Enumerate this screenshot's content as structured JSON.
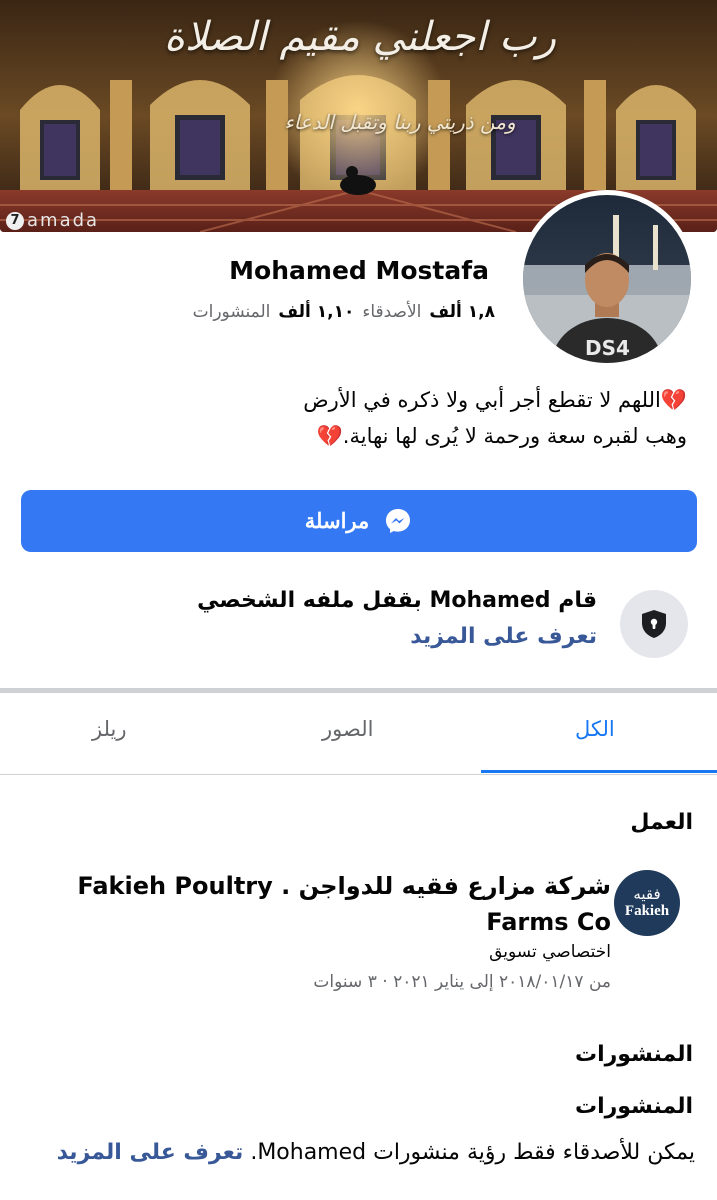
{
  "cover": {
    "title": "رب اجعلني مقيم الصلاة",
    "subtitle": "ومن ذريتي ربنا وتقبل الدعاء",
    "watermark_digit": "7",
    "watermark_text": "amada"
  },
  "profile": {
    "name": "Mohamed Mostafa",
    "friends_count": "١,٨ ألف",
    "friends_label": "الأصدقاء",
    "posts_count": "١,١٠ ألف",
    "posts_label": "المنشورات"
  },
  "bio": {
    "line1": "💔اللهم لا تقطع أجر أبي ولا ذكره في الأرض",
    "line2": "وهب لقبره سعة ورحمة لا يُرى لها نهاية.💔"
  },
  "message_button": {
    "label": "مراسلة",
    "color": "#3578f3"
  },
  "locked_profile": {
    "text": "قام Mohamed بقفل ملفه الشخصي",
    "link": "تعرف على المزيد"
  },
  "tabs": [
    {
      "label": "الكل",
      "active": true
    },
    {
      "label": "الصور",
      "active": false
    },
    {
      "label": "ريلز",
      "active": false
    }
  ],
  "work": {
    "section_title": "العمل",
    "logo_ar": "فقيه",
    "logo_en": "Fakieh",
    "company": "شركة مزارع فقيه للدواجن . Fakieh Poultry Farms Co",
    "job_title": "اختصاصي تسويق",
    "dates": "من ٢٠١٨/٠١/١٧ إلى يناير ٢٠٢١ · ٣ سنوات"
  },
  "posts": {
    "section_title": "المنشورات",
    "subtitle": "المنشورات",
    "privacy_text": "يمكن للأصدقاء فقط رؤية منشورات Mohamed.",
    "privacy_link": "تعرف على المزيد"
  },
  "colors": {
    "accent": "#1877f2",
    "link": "#385898",
    "secondary_text": "#65676b"
  }
}
